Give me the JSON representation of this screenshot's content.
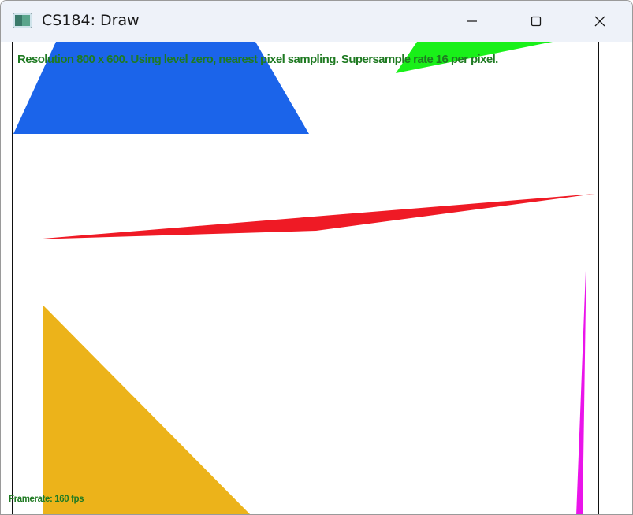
{
  "window": {
    "title": "CS184: Draw"
  },
  "icons": {
    "app": "app-window-icon",
    "minimize": "minimize-icon",
    "maximize": "maximize-icon",
    "close": "close-icon"
  },
  "overlay": {
    "status": "Resolution 800 x 600. Using level zero, nearest pixel sampling. Supersample rate 16 per pixel.",
    "framerate": "Framerate: 160 fps"
  },
  "colors": {
    "titlebar": "#eef2f9",
    "overlay_text": "#1f7a22",
    "triangle_blue": "#1b64ea",
    "triangle_green": "#19f019",
    "triangle_red": "#ef1a25",
    "triangle_yellow": "#ecb31a",
    "triangle_magenta": "#ea14ea"
  }
}
